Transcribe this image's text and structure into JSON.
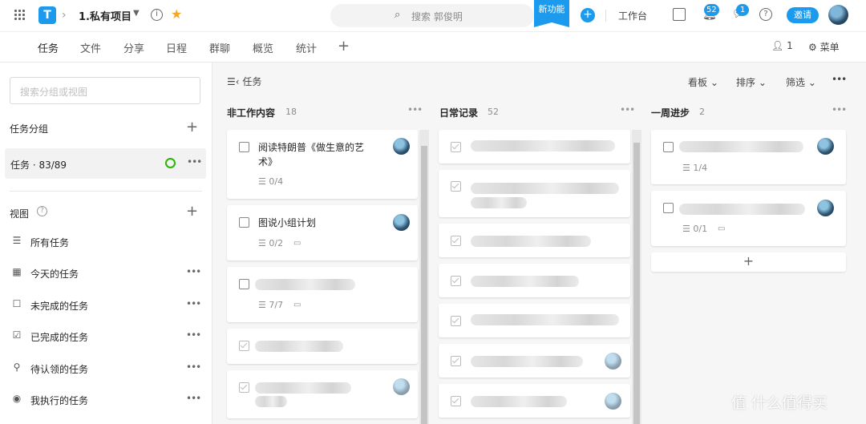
{
  "topbar": {
    "project_name": "1.私有项目",
    "search_placeholder": "搜索 郭俊明",
    "new_feature": "新功能",
    "workbench": "工作台",
    "notifications_count": "52",
    "messages_count": "1",
    "invite": "邀请"
  },
  "tabs": [
    "任务",
    "文件",
    "分享",
    "日程",
    "群聊",
    "概览",
    "统计"
  ],
  "tab_actions": {
    "members_count": "1",
    "menu": "菜单"
  },
  "sidebar": {
    "search_placeholder": "搜索分组或视图",
    "groups_title": "任务分组",
    "group_item": "任务 · 83/89",
    "views_title": "视图",
    "views": [
      {
        "label": "所有任务",
        "icon": "list-icon"
      },
      {
        "label": "今天的任务",
        "icon": "calendar-icon"
      },
      {
        "label": "未完成的任务",
        "icon": "checkbox-empty-icon"
      },
      {
        "label": "已完成的任务",
        "icon": "checkbox-checked-icon"
      },
      {
        "label": "待认领的任务",
        "icon": "user-add-icon"
      },
      {
        "label": "我执行的任务",
        "icon": "user-circle-icon"
      }
    ]
  },
  "board": {
    "title": "任务",
    "tools": {
      "kanban": "看板",
      "sort": "排序",
      "filter": "筛选"
    },
    "columns": [
      {
        "name": "非工作内容",
        "count": "18",
        "cards": [
          {
            "title": "阅读特朗普《做生意的艺术》",
            "subtasks": "0/4"
          },
          {
            "title": "图说小组计划",
            "subtasks": "0/2"
          },
          {
            "title": "",
            "subtasks": "7/7"
          }
        ]
      },
      {
        "name": "日常记录",
        "count": "52"
      },
      {
        "name": "一周进步",
        "count": "2",
        "cards": [
          {
            "subtasks": "1/4"
          },
          {
            "subtasks": "0/1"
          }
        ]
      }
    ]
  },
  "watermark": "值 什么值得买",
  "colors": {
    "accent": "#1b9aee",
    "done_ring": "#2db400",
    "star": "#f5a623"
  }
}
